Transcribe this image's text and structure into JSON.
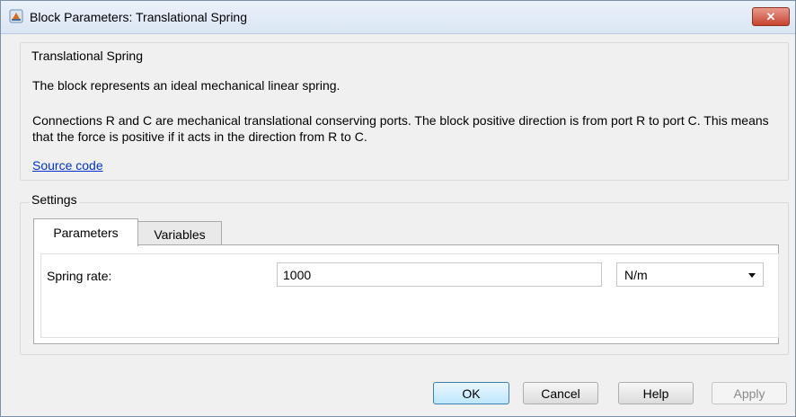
{
  "window": {
    "title": "Block Parameters: Translational Spring",
    "close_label": "✕"
  },
  "description": {
    "group_title": "Translational Spring",
    "line1": "The block represents an ideal mechanical linear spring.",
    "line2": "Connections R and C are mechanical translational conserving ports. The block positive direction is from port R to port C. This means that the force is positive if it acts in the direction from R to C.",
    "link": "Source code"
  },
  "settings": {
    "group_title": "Settings",
    "tabs": [
      {
        "label": "Parameters",
        "active": true
      },
      {
        "label": "Variables",
        "active": false
      }
    ],
    "spring_rate": {
      "label": "Spring rate:",
      "value": "1000",
      "unit": "N/m"
    }
  },
  "buttons": {
    "ok": "OK",
    "cancel": "Cancel",
    "help": "Help",
    "apply": "Apply"
  }
}
